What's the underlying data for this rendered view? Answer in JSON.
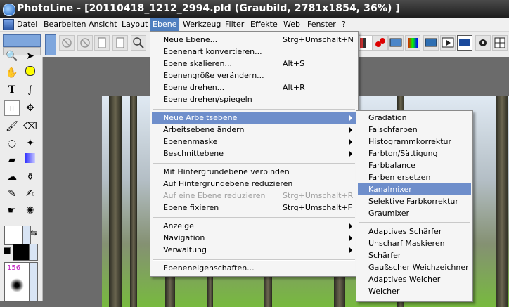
{
  "window": {
    "title": "PhotoLine - [20110418_1212_2994.pld  (Graubild, 2781x1854, 36%) ]"
  },
  "menubar": {
    "items": [
      "Datei",
      "Bearbeiten",
      "Ansicht",
      "Layout",
      "Ebene",
      "Werkzeug",
      "Filter",
      "Effekte",
      "Web",
      "Fenster",
      "?"
    ],
    "active": "Ebene"
  },
  "ebene_menu": {
    "items": [
      {
        "label": "Neue Ebene...",
        "shortcut": "Strg+Umschalt+N"
      },
      {
        "label": "Ebenenart konvertieren...",
        "shortcut": ""
      },
      {
        "label": "Ebene skalieren...",
        "shortcut": "Alt+S"
      },
      {
        "label": "Ebenengröße verändern...",
        "shortcut": ""
      },
      {
        "label": "Ebene drehen...",
        "shortcut": "Alt+R"
      },
      {
        "label": "Ebene drehen/spiegeln",
        "shortcut": ""
      },
      {
        "label": "Neue Arbeitsebene",
        "shortcut": "",
        "submenu": true,
        "highlighted": true
      },
      {
        "label": "Arbeitsebene ändern",
        "shortcut": "",
        "submenu": true
      },
      {
        "label": "Ebenenmaske",
        "shortcut": "",
        "submenu": true
      },
      {
        "label": "Beschnittebene",
        "shortcut": "",
        "submenu": true
      },
      {
        "label": "Mit Hintergrundebene verbinden",
        "shortcut": ""
      },
      {
        "label": "Auf Hintergrundebene reduzieren",
        "shortcut": ""
      },
      {
        "label": "Auf eine Ebene reduzieren",
        "shortcut": "Strg+Umschalt+R",
        "disabled": true
      },
      {
        "label": "Ebene fixieren",
        "shortcut": "Strg+Umschalt+F"
      },
      {
        "label": "Anzeige",
        "shortcut": "",
        "submenu": true
      },
      {
        "label": "Navigation",
        "shortcut": "",
        "submenu": true
      },
      {
        "label": "Verwaltung",
        "shortcut": "",
        "submenu": true
      },
      {
        "label": "Ebeneneigenschaften...",
        "shortcut": ""
      }
    ]
  },
  "arbeitsebene_submenu": {
    "items": [
      "Gradation",
      "Falschfarben",
      "Histogrammkorrektur",
      "Farbton/Sättigung",
      "Farbbalance",
      "Farben ersetzen",
      "Kanalmixer",
      "Selektive Farbkorrektur",
      "Graumixer",
      "Adaptives Schärfer",
      "Unscharf Maskieren",
      "Schärfer",
      "Gaußscher Weichzeichner",
      "Adaptives Weicher",
      "Weicher"
    ],
    "highlighted": "Kanalmixer"
  },
  "brush": {
    "size": "156"
  },
  "colors": {
    "accent": "#4f7fbf",
    "highlight": "#6e8ecb"
  }
}
